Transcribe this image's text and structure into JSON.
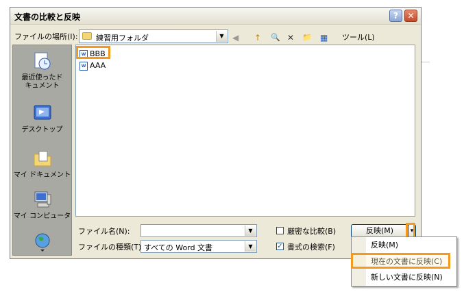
{
  "dialog": {
    "title": "文書の比較と反映",
    "help_label": "?",
    "close_label": "✕"
  },
  "toolbar": {
    "lookin_label": "ファイルの場所(I):",
    "lookin_value": "練習用フォルダ",
    "back_icon": "◀",
    "up_icon": "↑",
    "search_icon": "🔍",
    "delete_icon": "✕",
    "new_folder_icon": "📁",
    "views_icon": "▦",
    "tools_label": "ツール(L)",
    "dropdown_arrow": "▼"
  },
  "places": [
    {
      "label": "最近使ったド\nキュメント"
    },
    {
      "label": "デスクトップ"
    },
    {
      "label": "マイ ドキュメント"
    },
    {
      "label": "マイ コンピュータ"
    }
  ],
  "files": [
    {
      "name": "BBB"
    },
    {
      "name": "AAA"
    }
  ],
  "form": {
    "filename_label": "ファイル名(N):",
    "filename_value": "",
    "filetype_label": "ファイルの種類(T):",
    "filetype_value": "すべての Word 文書",
    "strict_compare_label": "厳密な比較(B)",
    "strict_compare_checked": false,
    "format_search_label": "書式の検索(F)",
    "format_search_checked": true,
    "merge_button_label": "反映(M)",
    "split_arrow": "▾"
  },
  "merge_menu": [
    {
      "label": "反映(M)"
    },
    {
      "label": "現在の文書に反映(C)"
    },
    {
      "label": "新しい文書に反映(N)"
    }
  ],
  "colors": {
    "highlight": "#f39a1e",
    "dialog_bg": "#ece9d8",
    "places_bg": "#a9a9a4"
  }
}
